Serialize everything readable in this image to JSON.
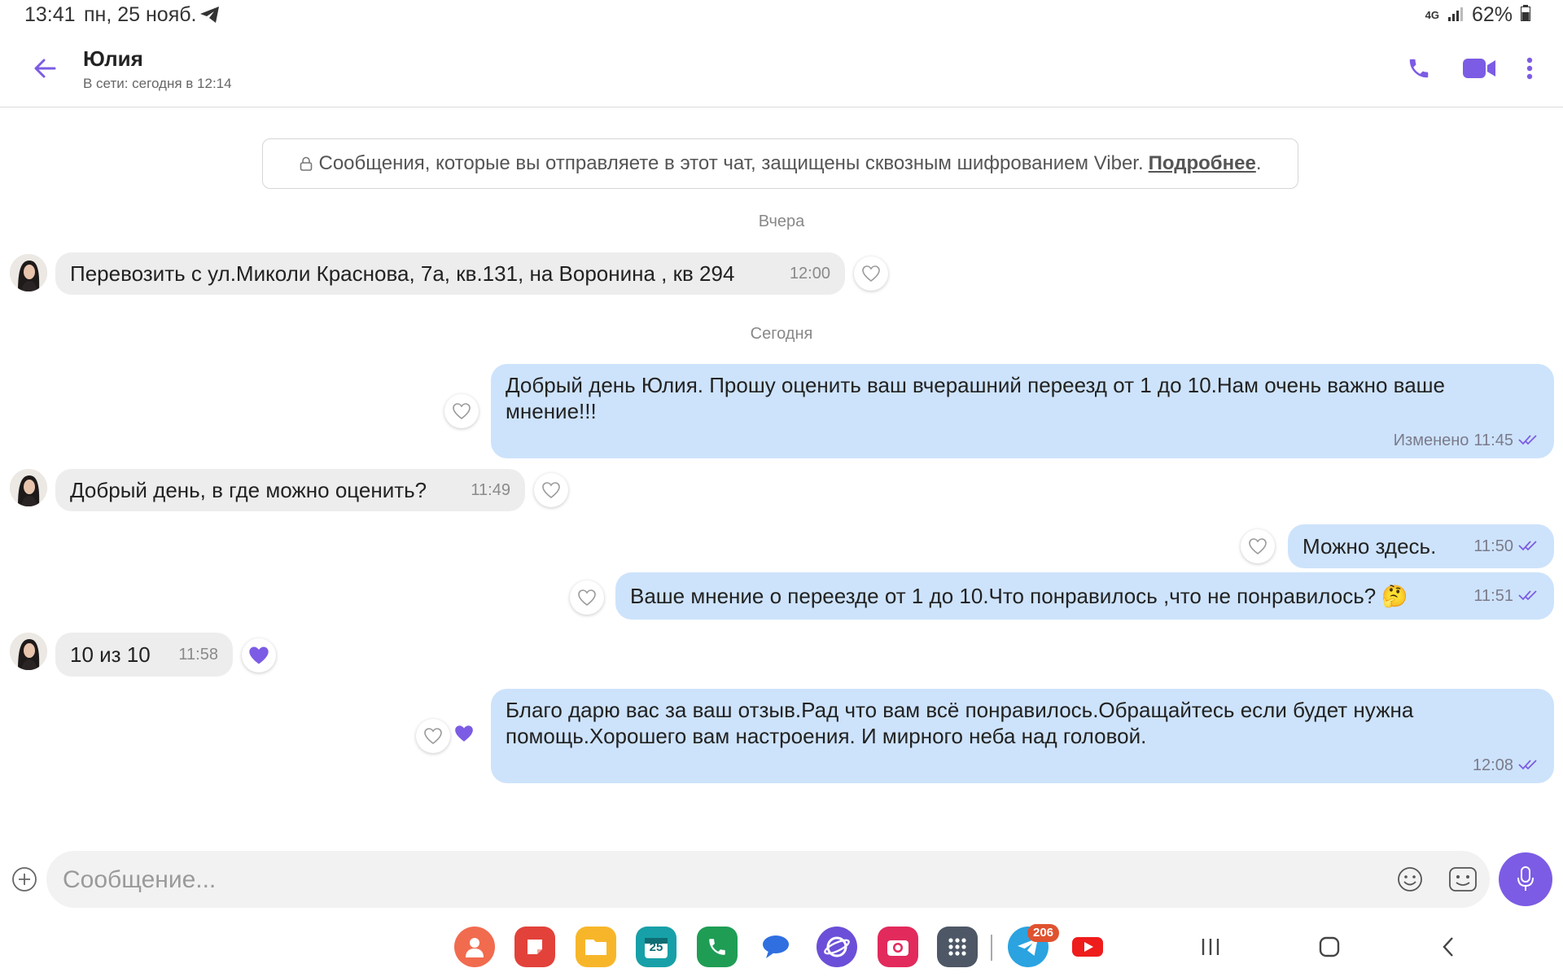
{
  "status_bar": {
    "time": "13:41",
    "date": "пн, 25 нояб.",
    "network": "4G",
    "battery": "62%"
  },
  "header": {
    "contact_name": "Юлия",
    "contact_status": "В сети: сегодня в 12:14",
    "icons": [
      "back-arrow-icon",
      "phone-icon",
      "video-call-icon",
      "more-vert-icon"
    ]
  },
  "notice": {
    "text": "Сообщения, которые вы отправляете в этот чат, защищены сквозным шифрованием Viber.",
    "link": "Подробнее",
    "suffix": "."
  },
  "day_separators": {
    "yesterday": "Вчера",
    "today": "Сегодня"
  },
  "messages": [
    {
      "direction": "in",
      "text": "Перевозить с ул.Миколи Краснова, 7а, кв.131, на Воронина , кв 294",
      "time": "12:00",
      "liked": false
    },
    {
      "direction": "out",
      "text": "Добрый день Юлия. Прошу оценить ваш вчерашний переезд от 1 до 10.Нам очень важно ваше мнение!!!",
      "edited_label": "Изменено",
      "time": "11:45",
      "liked": false
    },
    {
      "direction": "in",
      "text": "Добрый день, в где можно оценить?",
      "time": "11:49",
      "liked": false
    },
    {
      "direction": "out",
      "text": "Можно здесь.",
      "time": "11:50",
      "liked": false
    },
    {
      "direction": "out",
      "text": "Ваше мнение о переезде от 1 до 10.Что понравилось ,что не понравилось? 🤔",
      "time": "11:51",
      "liked": false
    },
    {
      "direction": "in",
      "text": "10 из 10",
      "time": "11:58",
      "liked": true
    },
    {
      "direction": "out",
      "text": "Благо дарю вас за ваш отзыв.Рад что вам всё понравилось.Обращайтесь если будет нужна помощь.Хорошего вам настроения. И мирного неба над головой.",
      "time": "12:08",
      "liked": false,
      "received_like": true
    }
  ],
  "composer": {
    "placeholder": "Сообщение..."
  },
  "taskbar": {
    "apps": [
      "contacts-icon",
      "notes-icon",
      "files-icon",
      "calendar-icon",
      "phone-app-icon",
      "messages-icon",
      "browser-icon",
      "camera-icon",
      "app-drawer-icon",
      "telegram-icon",
      "youtube-icon"
    ],
    "calendar_day": "25",
    "telegram_badge": "206"
  },
  "colors": {
    "accent": "#7c5ce4",
    "outgoing_bubble": "#cde3fb",
    "incoming_bubble": "#ededed"
  }
}
